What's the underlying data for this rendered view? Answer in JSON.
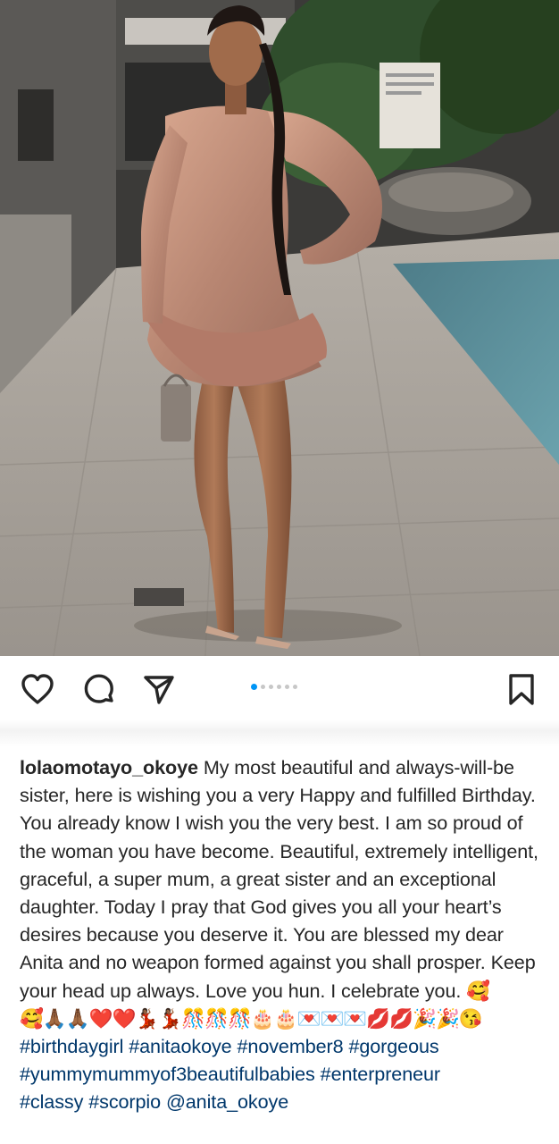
{
  "post": {
    "username": "lolaomotayo_okoye",
    "caption_text": "My most beautiful and always-will-be sister, here is wishing you a very Happy and fulfilled Birthday. You already know I wish you the very best. I am so proud of the woman you have become. Beautiful, extremely intelligent, graceful, a super mum, a great sister and an exceptional daughter. Today I pray that God gives you all your heart’s desires because you deserve it. You are blessed my dear Anita and no weapon formed against you shall prosper. Keep your head up always. Love you hun. I celebrate you. 🥰",
    "emoji_line": "🥰🙏🏾🙏🏾❤️❤️💃🏾💃🏾🎊🎊🎊🎂🎂💌💌💌💋💋🎉🎉😘",
    "hashtags": [
      "#birthdaygirl",
      "#anitaokoye",
      "#november8",
      "#gorgeous",
      "#yummymummyof3beautifulbabies",
      "#enterpreneur",
      "#classy",
      "#scorpio"
    ],
    "mention": "@anita_okoye"
  },
  "actions": {
    "like_icon": "heart-icon",
    "comment_icon": "comment-icon",
    "share_icon": "send-icon",
    "save_icon": "bookmark-icon"
  },
  "carousel": {
    "total": 6,
    "active_index": 0
  },
  "colors": {
    "text": "#262626",
    "link": "#00376b",
    "carousel_active": "#0095f6",
    "carousel_inactive": "#c7c7c7"
  }
}
